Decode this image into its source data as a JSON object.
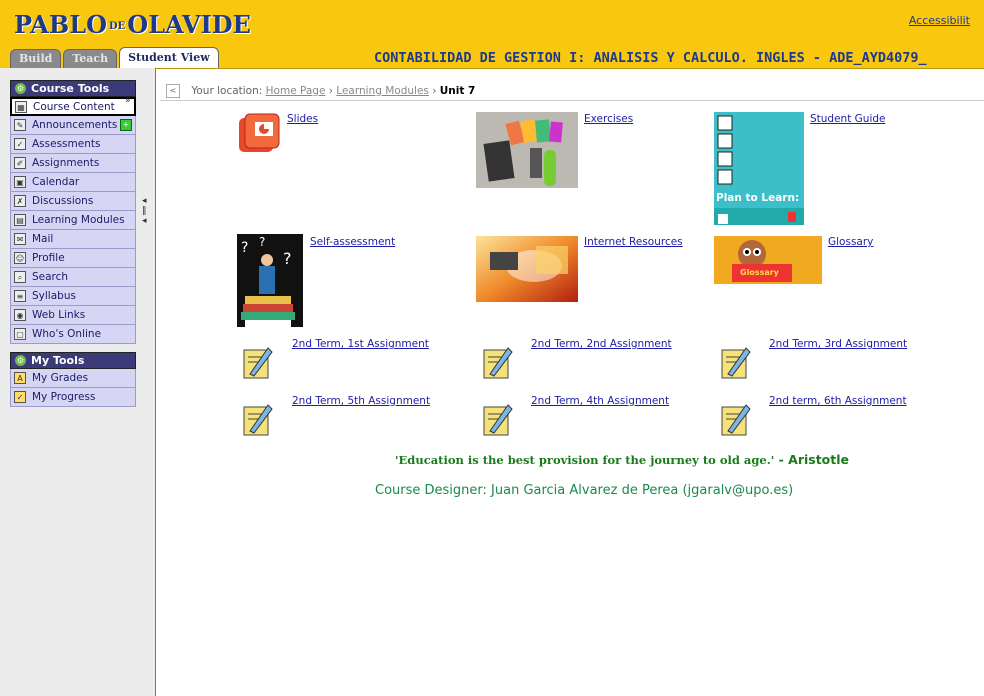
{
  "header": {
    "logo": {
      "left": "PABLO",
      "mid": "DE",
      "right": "OLAVIDE"
    },
    "accessibility": "Accessibilit",
    "tabs": [
      {
        "label": "Build"
      },
      {
        "label": "Teach"
      },
      {
        "label": "Student View"
      }
    ],
    "course_title": "CONTABILIDAD DE GESTION I: ANALISIS Y CALCULO. INGLES - ADE_AYD4079_"
  },
  "sidebar": {
    "course_tools_title": "Course Tools",
    "items": [
      {
        "label": "Course Content",
        "icon": "course-content-icon"
      },
      {
        "label": "Announcements",
        "icon": "announcements-icon"
      },
      {
        "label": "Assessments",
        "icon": "assessments-icon"
      },
      {
        "label": "Assignments",
        "icon": "assignments-icon"
      },
      {
        "label": "Calendar",
        "icon": "calendar-icon"
      },
      {
        "label": "Discussions",
        "icon": "discussions-icon"
      },
      {
        "label": "Learning Modules",
        "icon": "learning-modules-icon"
      },
      {
        "label": "Mail",
        "icon": "mail-icon"
      },
      {
        "label": "Profile",
        "icon": "profile-icon"
      },
      {
        "label": "Search",
        "icon": "search-icon"
      },
      {
        "label": "Syllabus",
        "icon": "syllabus-icon"
      },
      {
        "label": "Web Links",
        "icon": "web-links-icon"
      },
      {
        "label": "Who's Online",
        "icon": "whos-online-icon"
      }
    ],
    "my_tools_title": "My Tools",
    "my_items": [
      {
        "label": "My Grades",
        "icon": "grades-icon"
      },
      {
        "label": "My Progress",
        "icon": "progress-icon"
      }
    ]
  },
  "breadcrumb": {
    "prefix": "Your location:",
    "home": "Home Page",
    "modules": "Learning Modules",
    "current": "Unit 7",
    "separator": "›"
  },
  "content": {
    "row1": [
      {
        "label": "Slides"
      },
      {
        "label": "Exercises"
      },
      {
        "label": "Student Guide"
      }
    ],
    "row2": [
      {
        "label": "Self-assessment"
      },
      {
        "label": "Internet Resources"
      },
      {
        "label": "Glossary"
      }
    ],
    "assignments": [
      {
        "label": "2nd Term, 1st Assignment"
      },
      {
        "label": "2nd Term, 2nd Assignment"
      },
      {
        "label": "2nd Term, 3rd Assignment"
      },
      {
        "label": "2nd Term, 5th Assignment"
      },
      {
        "label": "2nd Term, 4th Assignment"
      },
      {
        "label": "2nd term, 6th Assignment"
      }
    ],
    "guide_cover_text": "Plan to Learn:",
    "glossary_book_text": "Glossary"
  },
  "quote": {
    "text": "'Education is the best provision for the journey to old age.'",
    "author": " - Aristotle"
  },
  "designer": "Course Designer: Juan Garcia Alvarez de Perea (jgaralv@upo.es)",
  "colors": {
    "header": "#f9c80e",
    "nav_blue": "#1d3a8a",
    "link": "#1d1da8",
    "quote_green": "#1a7a1a"
  }
}
